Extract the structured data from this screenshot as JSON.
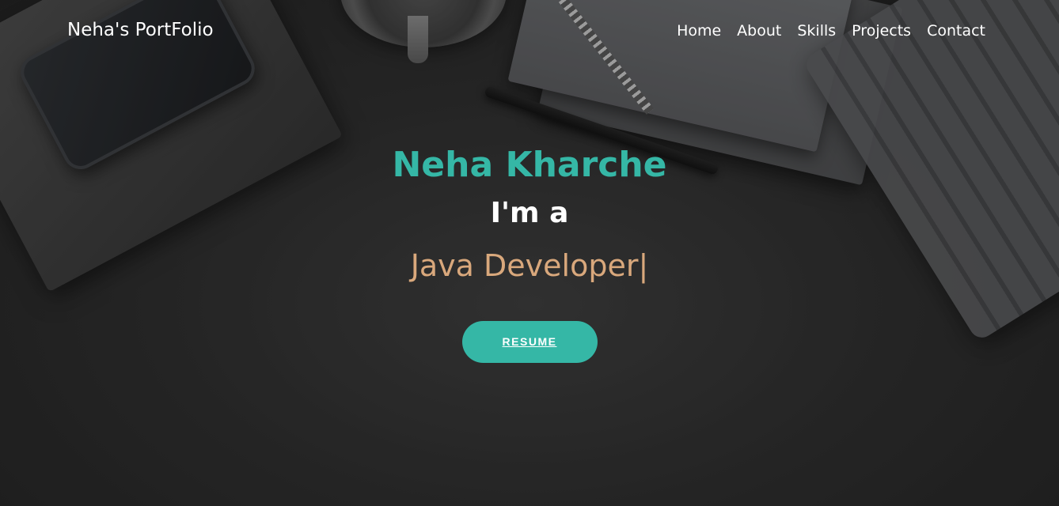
{
  "navbar": {
    "brand": "Neha's PortFolio",
    "links": [
      "Home",
      "About",
      "Skills",
      "Projects",
      "Contact"
    ]
  },
  "hero": {
    "name": "Neha Kharche",
    "intro": "I'm a",
    "role": "Java Developer",
    "cursor": "|",
    "resume_label": "RESUME"
  },
  "colors": {
    "accent": "#35b7a6",
    "role_text": "#d9a87c",
    "text": "#ffffff",
    "background": "#2b2b2b"
  }
}
